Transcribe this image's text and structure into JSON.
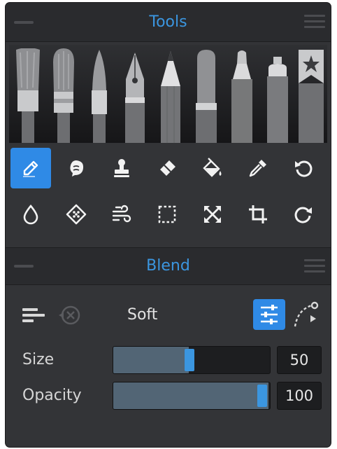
{
  "tools_panel": {
    "title": "Tools",
    "brushes": [
      "flat-brush-icon",
      "filbert-brush-icon",
      "round-brush-icon",
      "fountain-pen-icon",
      "pencil-icon",
      "marker-icon",
      "felt-pen-icon",
      "spray-can-icon",
      "favorite-brush-icon"
    ],
    "tool_row_1": [
      "brush-tool-icon",
      "smudge-tool-icon",
      "stamp-tool-icon",
      "eraser-tool-icon",
      "fill-tool-icon",
      "eyedropper-tool-icon",
      "undo-icon"
    ],
    "tool_row_2": [
      "water-drop-icon",
      "texture-tool-icon",
      "blow-tool-icon",
      "selection-tool-icon",
      "transform-tool-icon",
      "crop-tool-icon",
      "redo-icon"
    ],
    "active_tool": "brush-tool-icon"
  },
  "blend_panel": {
    "title": "Blend",
    "mode": "Soft",
    "size_label": "Size",
    "size_value": "50",
    "size_fraction": 0.5,
    "opacity_label": "Opacity",
    "opacity_value": "100",
    "opacity_fraction": 1.0
  },
  "colors": {
    "accent": "#3b96e0",
    "panel_bg": "#333437",
    "header_bg": "#2a2b2e"
  }
}
